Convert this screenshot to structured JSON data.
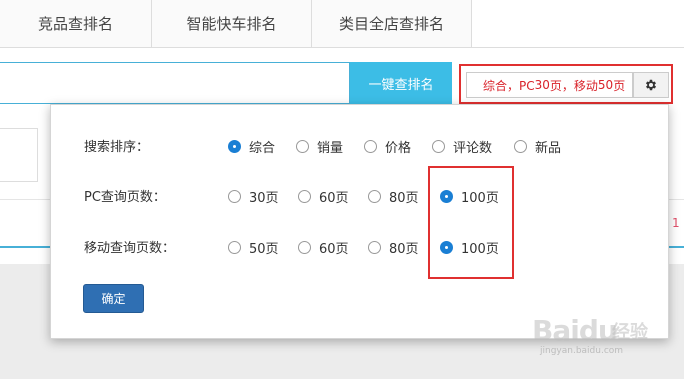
{
  "tabs": [
    {
      "label": "竞品查排名"
    },
    {
      "label": "智能快车排名"
    },
    {
      "label": "类目全店查排名"
    }
  ],
  "search": {
    "button_label": "一键查排名"
  },
  "settings_summary": {
    "part1": "综合，PC",
    "pc_pages": "30",
    "part2": "页，移动",
    "mobile_pages": "50",
    "part3": "页",
    "accent_color": "#d9222a"
  },
  "gear_icon": "gear-icon",
  "background": {
    "page_num": "1"
  },
  "popup": {
    "sort": {
      "label": "搜索排序：",
      "options": [
        "综合",
        "销量",
        "价格",
        "评论数",
        "新品"
      ],
      "selected": "综合"
    },
    "pc_pages": {
      "label": "PC查询页数：",
      "options": [
        "30页",
        "60页",
        "80页",
        "100页"
      ],
      "selected": "100页"
    },
    "mobile_pages": {
      "label": "移动查询页数：",
      "options": [
        "50页",
        "60页",
        "80页",
        "100页"
      ],
      "selected": "100页"
    },
    "confirm_label": "确定"
  },
  "watermark": {
    "brand": "Baidu",
    "cn": "经验",
    "url": "jingyan.baidu.com"
  },
  "colors": {
    "primary_button": "#3cbde6",
    "confirm_button": "#2f6fb3",
    "radio_selected": "#1a7fd4",
    "highlight_border": "#e03030"
  }
}
